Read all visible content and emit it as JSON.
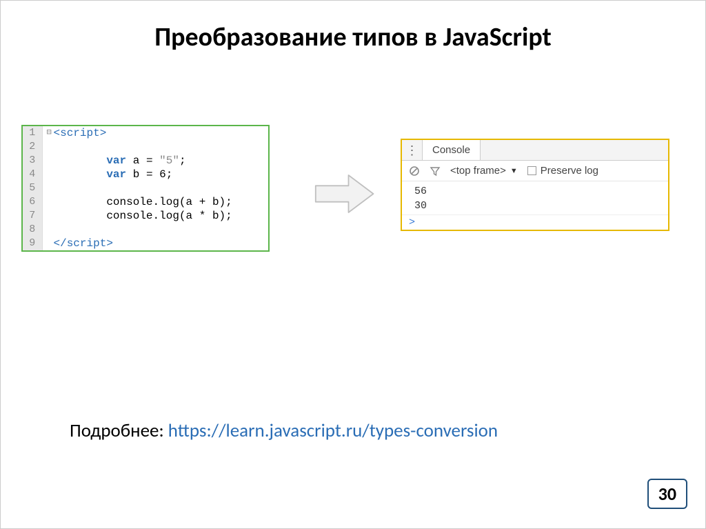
{
  "title": "Преобразование типов в JavaScript",
  "code": {
    "lines": [
      {
        "n": "1",
        "fold": "⊟",
        "html": "<span class='k-tag'>&lt;script&gt;</span>"
      },
      {
        "n": "2",
        "fold": "",
        "html": ""
      },
      {
        "n": "3",
        "fold": "",
        "indent": true,
        "html": "<span class='k-var'>var</span> <span class='k-id'>a = </span><span class='k-str'>\"5\"</span><span class='k-id'>;</span>"
      },
      {
        "n": "4",
        "fold": "",
        "indent": true,
        "html": "<span class='k-var'>var</span> <span class='k-id'>b = 6;</span>"
      },
      {
        "n": "5",
        "fold": "",
        "html": ""
      },
      {
        "n": "6",
        "fold": "",
        "indent": true,
        "html": "<span class='k-id'>console.log(a + b);</span>"
      },
      {
        "n": "7",
        "fold": "",
        "indent": true,
        "html": "<span class='k-id'>console.log(a * b);</span>"
      },
      {
        "n": "8",
        "fold": "",
        "html": ""
      },
      {
        "n": "9",
        "fold": "",
        "html": "<span class='k-tag'>&lt;/script&gt;</span>"
      }
    ]
  },
  "console": {
    "tab_label": "Console",
    "frame_label": "<top frame>",
    "preserve_label": "Preserve log",
    "output": [
      "56",
      "30"
    ],
    "prompt": ">"
  },
  "footer": {
    "prefix": "Подробнее: ",
    "link": "https://learn.javascript.ru/types-conversion"
  },
  "page_number": "30"
}
